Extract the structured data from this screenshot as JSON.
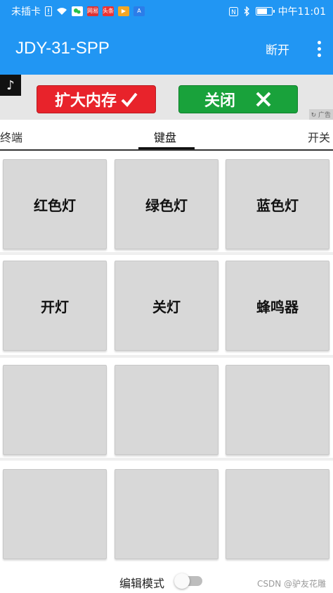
{
  "status_bar": {
    "carrier": "未插卡",
    "apps": [
      {
        "icon": "wechat-icon",
        "color": "#26c24b",
        "label": ""
      },
      {
        "icon": "netease-news-icon",
        "color": "#d33",
        "label": "网易"
      },
      {
        "icon": "toutiao-icon",
        "color": "#e33",
        "label": "头条"
      },
      {
        "icon": "video-icon",
        "color": "#f5a623",
        "label": "▶"
      },
      {
        "icon": "appstore-icon",
        "color": "#2b7de9",
        "label": "A"
      }
    ],
    "time": "中午11:01",
    "battery_level": 0.75
  },
  "app_bar": {
    "title": "JDY-31-SPP",
    "disconnect_label": "断开"
  },
  "ad": {
    "logo_glyph": "♪",
    "expand_label": "扩大内存",
    "close_label": "关闭",
    "tag": "广告"
  },
  "tabs": [
    {
      "label": "终端"
    },
    {
      "label": "键盘"
    },
    {
      "label": "开关"
    }
  ],
  "grid": {
    "rows": [
      [
        "红色灯",
        "绿色灯",
        "蓝色灯"
      ],
      [
        "开灯",
        "关灯",
        "蜂鸣器"
      ],
      [
        "",
        "",
        ""
      ],
      [
        "",
        "",
        ""
      ]
    ]
  },
  "bottom": {
    "edit_mode_label": "编辑模式",
    "edit_mode_on": false,
    "watermark": "CSDN @驴友花雕"
  }
}
